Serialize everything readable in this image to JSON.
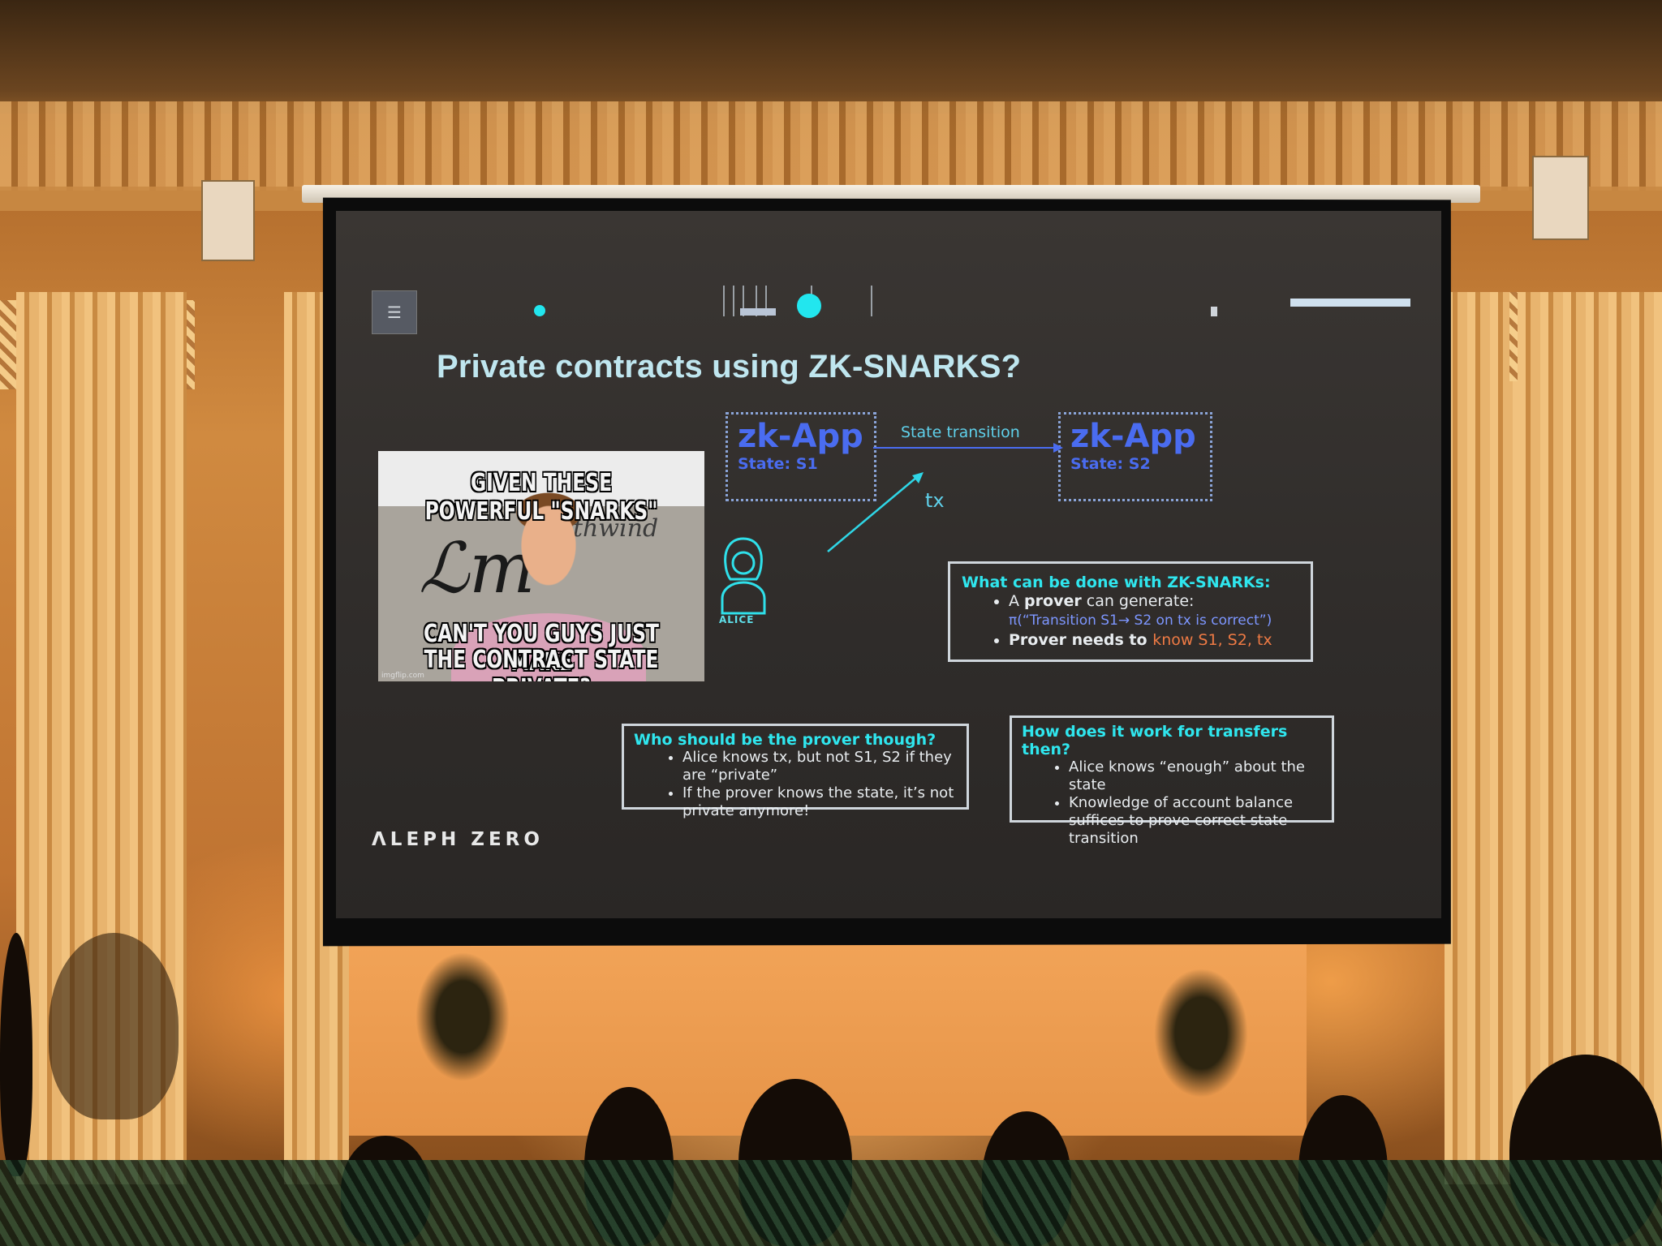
{
  "slide": {
    "menu_glyph": "☰",
    "title": "Private contracts using ZK-SNARKS?",
    "meme": {
      "top_text": "GIVEN THESE POWERFUL \"SNARKS\"",
      "bottom_line1": "CAN'T YOU GUYS JUST MAKE",
      "bottom_line2": "THE CONTRACT STATE PRIVATE?",
      "credit": "imgflip.com"
    },
    "diagram": {
      "app_left": {
        "title": "zk-App",
        "state": "State: S1"
      },
      "app_right": {
        "title": "zk-App",
        "state": "State: S2"
      },
      "transition_label": "State transition",
      "tx_label": "tx",
      "actor_label": "ALICE"
    },
    "box_snarks": {
      "heading": "What can be done with ZK-SNARKs:",
      "item1_prefix": "A ",
      "item1_bold": "prover",
      "item1_suffix": " can generate:",
      "item1_formula": "π(“Transition S1→ S2 on tx is correct”)",
      "item2_bold": "Prover needs to ",
      "item2_orange": "know S1, S2, tx"
    },
    "box_prover": {
      "heading": "Who should be the prover though?",
      "items": [
        "Alice knows tx, but not S1, S2 if they are “private”",
        "If the prover knows the state, it’s not private anymore!"
      ]
    },
    "box_transfers": {
      "heading": "How does it work for transfers then?",
      "items": [
        "Alice knows “enough” about the state",
        "Knowledge of account balance suffices to prove correct state transition"
      ]
    },
    "logo": "ΛLEPH ZERO"
  },
  "colors": {
    "title": "#bfe6ef",
    "accent_cyan": "#2fe6ee",
    "zk_blue": "#4a6cf0",
    "orange": "#ee7a44",
    "slide_bg": "#322f2c"
  }
}
